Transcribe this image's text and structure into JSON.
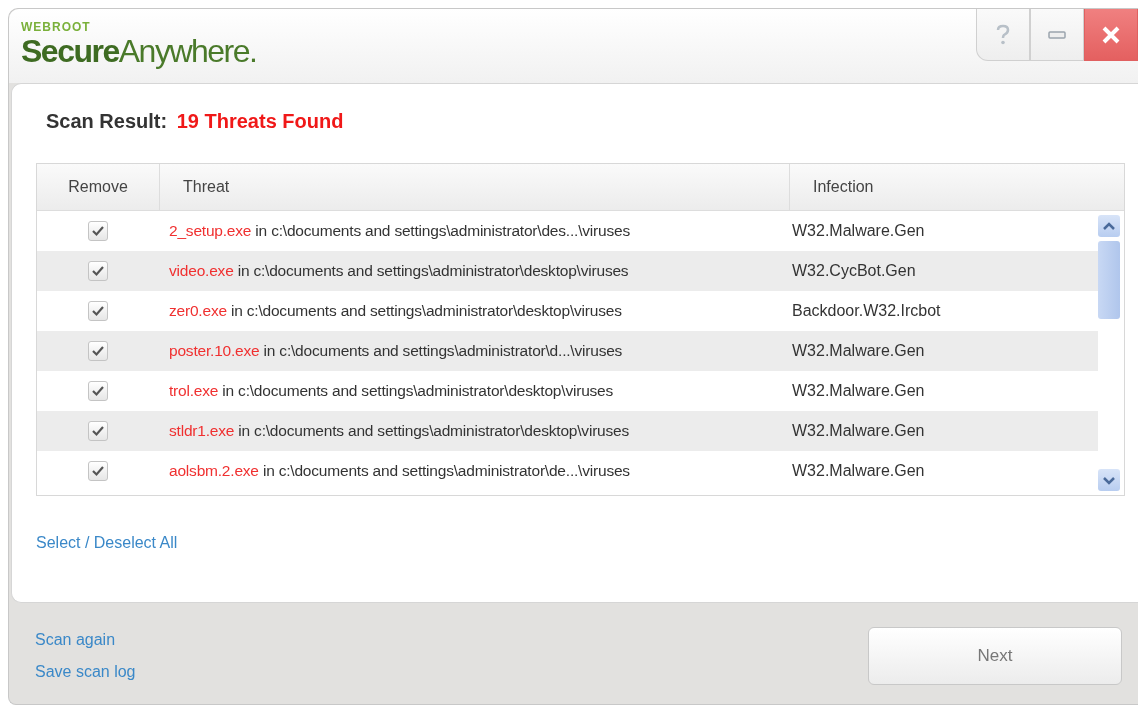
{
  "window": {
    "vendor": "WEBROOT",
    "product": "**Secure**Anywhere."
  },
  "result": {
    "label": "Scan Result:",
    "value": "19 Threats Found"
  },
  "table": {
    "columns": [
      "Remove",
      "Threat",
      "Infection"
    ],
    "rows": [
      {
        "checked": true,
        "file": "2_setup.exe",
        "location": "in c:\\documents and settings\\administrator\\des...\\viruses",
        "infection": "W32.Malware.Gen"
      },
      {
        "checked": true,
        "file": "video.exe",
        "location": "in c:\\documents and settings\\administrator\\desktop\\viruses",
        "infection": "W32.CycBot.Gen"
      },
      {
        "checked": true,
        "file": "zer0.exe",
        "location": "in c:\\documents and settings\\administrator\\desktop\\viruses",
        "infection": "Backdoor.W32.Ircbot"
      },
      {
        "checked": true,
        "file": "poster.10.exe",
        "location": "in c:\\documents and settings\\administrator\\d...\\viruses",
        "infection": "W32.Malware.Gen"
      },
      {
        "checked": true,
        "file": "trol.exe",
        "location": "in c:\\documents and settings\\administrator\\desktop\\viruses",
        "infection": "W32.Malware.Gen"
      },
      {
        "checked": true,
        "file": "stldr1.exe",
        "location": "in c:\\documents and settings\\administrator\\desktop\\viruses",
        "infection": "W32.Malware.Gen"
      },
      {
        "checked": true,
        "file": "aolsbm.2.exe",
        "location": "in c:\\documents and settings\\administrator\\de...\\viruses",
        "infection": "W32.Malware.Gen"
      }
    ]
  },
  "select_all": "Select / Deselect All",
  "footer_links": [
    "Scan again",
    "Save scan log"
  ],
  "next_button": "Next"
}
